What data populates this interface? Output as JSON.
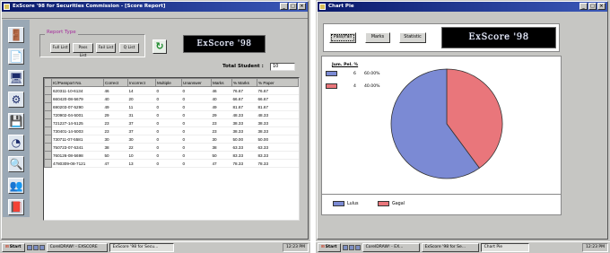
{
  "left": {
    "title": "ExScore '98 for Securities Commission  - [Score Report]",
    "report_type": {
      "legend": "Report Type",
      "buttons": [
        "Full List",
        "Pass List",
        "Fail List",
        "Q List"
      ]
    },
    "logo": "ExScore '98",
    "total_label": "Total Student :",
    "total_value": "10",
    "columns": [
      "IC/Passport No.",
      "Correct",
      "Incorrect",
      "Multiple",
      "Unanswer",
      "Marks",
      "% Marks",
      "% Paper"
    ],
    "rows": [
      [
        "620311-10-6134",
        "46",
        "14",
        "0",
        "0",
        "46",
        "76.67",
        "76.67"
      ],
      [
        "660420-08-5679",
        "40",
        "20",
        "0",
        "0",
        "40",
        "66.67",
        "66.67"
      ],
      [
        "690203-07-5290",
        "49",
        "11",
        "0",
        "0",
        "49",
        "81.67",
        "81.67"
      ],
      [
        "720902-04-5001",
        "29",
        "31",
        "0",
        "0",
        "29",
        "48.33",
        "48.33"
      ],
      [
        "721227-14-5125",
        "23",
        "37",
        "0",
        "0",
        "23",
        "38.33",
        "38.33"
      ],
      [
        "730401-14-5003",
        "23",
        "37",
        "0",
        "0",
        "23",
        "38.33",
        "38.33"
      ],
      [
        "730711-07-5581",
        "30",
        "30",
        "0",
        "0",
        "30",
        "50.00",
        "50.00"
      ],
      [
        "750723-07-5341",
        "38",
        "22",
        "0",
        "0",
        "38",
        "63.33",
        "63.33"
      ],
      [
        "760126-08-5698",
        "50",
        "10",
        "0",
        "0",
        "50",
        "83.33",
        "83.33"
      ],
      [
        "4780309-08-7121",
        "47",
        "13",
        "0",
        "0",
        "47",
        "78.33",
        "78.33"
      ]
    ],
    "taskbar": {
      "start": "Start",
      "items": [
        "CorelDRAW! - EXSCORE",
        "ExScore '98 for Secu..."
      ],
      "clock": "12:23 PM"
    }
  },
  "right": {
    "title": "Chart Pie",
    "buttons": [
      "Pass/Fail",
      "Marks",
      "Statistic"
    ],
    "logo": "ExScore '98",
    "legend_head": "Jum. Pel.  %",
    "legend_rows": [
      {
        "count": "6",
        "pct": "60.00%",
        "color": "#7b8ad4"
      },
      {
        "count": "4",
        "pct": "40.00%",
        "color": "#e9767b"
      }
    ],
    "bottom_legend": [
      {
        "label": "Lulus",
        "color": "#7b8ad4"
      },
      {
        "label": "Gagal",
        "color": "#e9767b"
      }
    ],
    "taskbar": {
      "start": "Start",
      "items": [
        "CorelDRAW! - EX...",
        "ExScore '98 for Se...",
        "Chart Pie"
      ],
      "clock": "12:23 PM"
    }
  },
  "chart_data": {
    "type": "pie",
    "categories": [
      "Lulus",
      "Gagal"
    ],
    "values": [
      6,
      4
    ],
    "percentages": [
      60.0,
      40.0
    ],
    "colors": [
      "#7b8ad4",
      "#e9767b"
    ],
    "legend": "bottom"
  }
}
